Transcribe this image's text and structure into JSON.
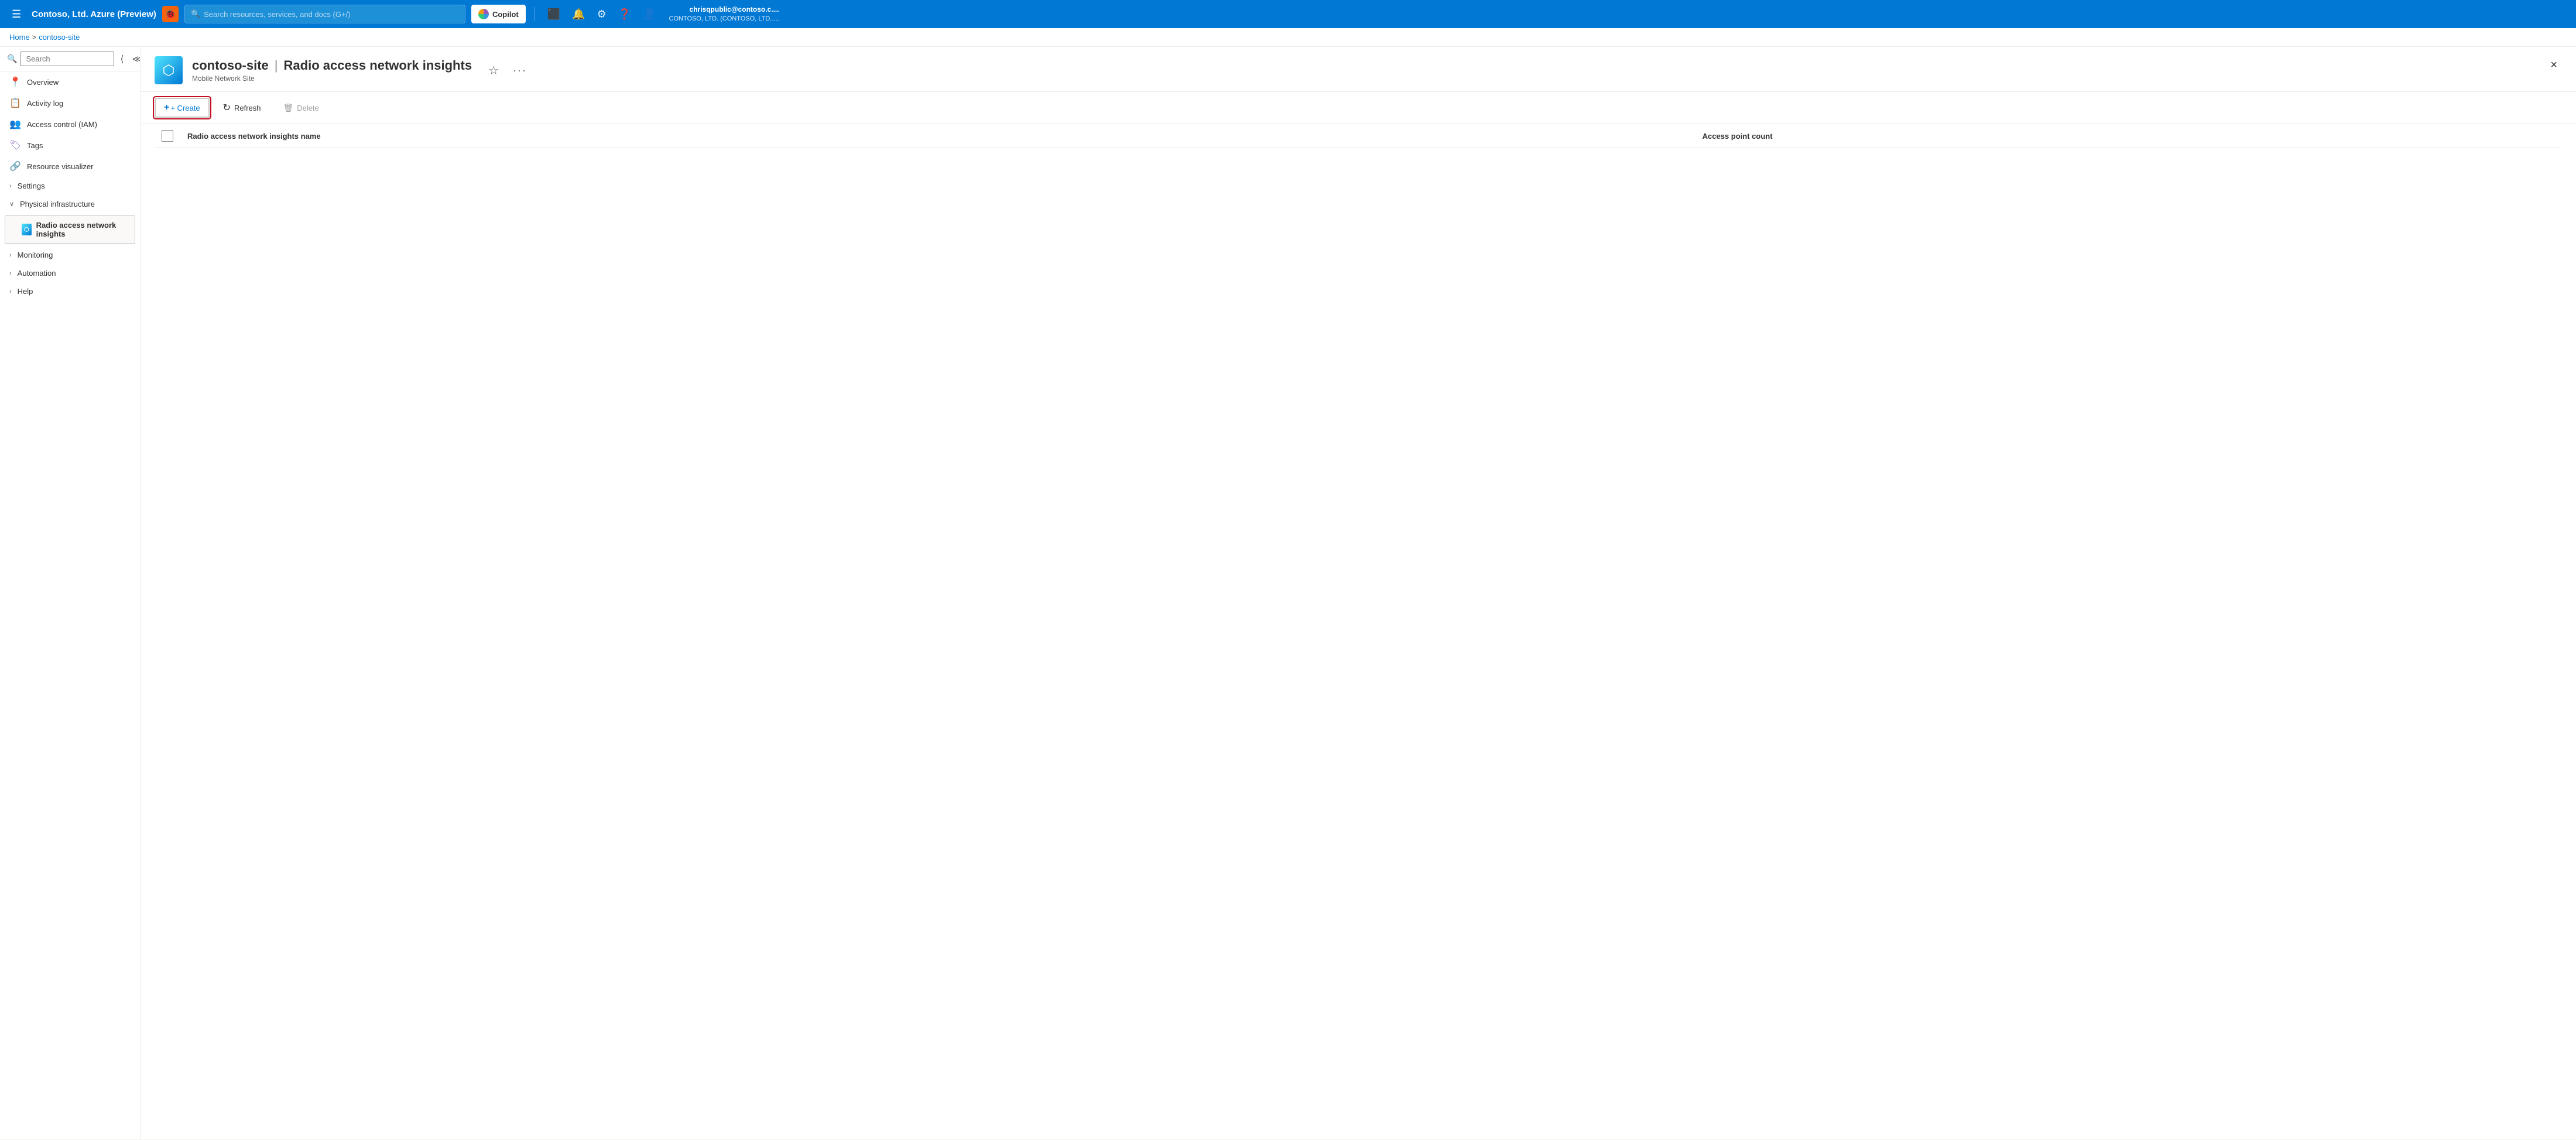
{
  "topNav": {
    "hamburger": "☰",
    "portalTitle": "Contoso, Ltd. Azure (Preview)",
    "bugIcon": "🐞",
    "searchPlaceholder": "Search resources, services, and docs (G+/)",
    "copilotLabel": "Copilot",
    "divider": true,
    "navIcons": [
      "📧",
      "🔔",
      "⚙",
      "❓",
      "👤"
    ],
    "userName": "chrisqpublic@contoso.c....",
    "userOrg": "CONTOSO, LTD. (CONTOSO, LTD....."
  },
  "breadcrumb": {
    "home": "Home",
    "sep": ">",
    "current": "contoso-site"
  },
  "sidebar": {
    "searchPlaceholder": "Search",
    "navItems": [
      {
        "id": "overview",
        "label": "Overview",
        "icon": "📍",
        "iconClass": "icon-pin"
      },
      {
        "id": "activity-log",
        "label": "Activity log",
        "icon": "📋",
        "iconClass": "icon-log"
      },
      {
        "id": "access-control",
        "label": "Access control (IAM)",
        "icon": "👥",
        "iconClass": "icon-iam"
      },
      {
        "id": "tags",
        "label": "Tags",
        "icon": "🏷",
        "iconClass": "icon-tag"
      },
      {
        "id": "resource-visualizer",
        "label": "Resource visualizer",
        "icon": "🔗",
        "iconClass": "icon-viz"
      }
    ],
    "sections": [
      {
        "id": "settings",
        "label": "Settings",
        "expanded": false,
        "chevron": "›"
      },
      {
        "id": "physical-infrastructure",
        "label": "Physical infrastructure",
        "expanded": true,
        "chevron": "∨",
        "subItems": [
          {
            "id": "radio-access-network",
            "label": "Radio access network insights",
            "active": true
          }
        ]
      },
      {
        "id": "monitoring",
        "label": "Monitoring",
        "expanded": false,
        "chevron": "›"
      },
      {
        "id": "automation",
        "label": "Automation",
        "expanded": false,
        "chevron": "›"
      },
      {
        "id": "help",
        "label": "Help",
        "expanded": false,
        "chevron": "›"
      }
    ]
  },
  "pageHeader": {
    "resourceName": "contoso-site",
    "separator": "|",
    "title": "Radio access network insights",
    "subtitle": "Mobile Network Site",
    "starIcon": "☆",
    "moreIcon": "···",
    "closeIcon": "×"
  },
  "toolbar": {
    "createLabel": "+ Create",
    "createIcon": "+",
    "refreshIcon": "↻",
    "refreshLabel": "Refresh",
    "deleteIcon": "🗑",
    "deleteLabel": "Delete"
  },
  "table": {
    "columns": [
      {
        "id": "checkbox",
        "label": ""
      },
      {
        "id": "name",
        "label": "Radio access network insights name"
      },
      {
        "id": "access-count",
        "label": "Access point count"
      }
    ],
    "rows": []
  }
}
